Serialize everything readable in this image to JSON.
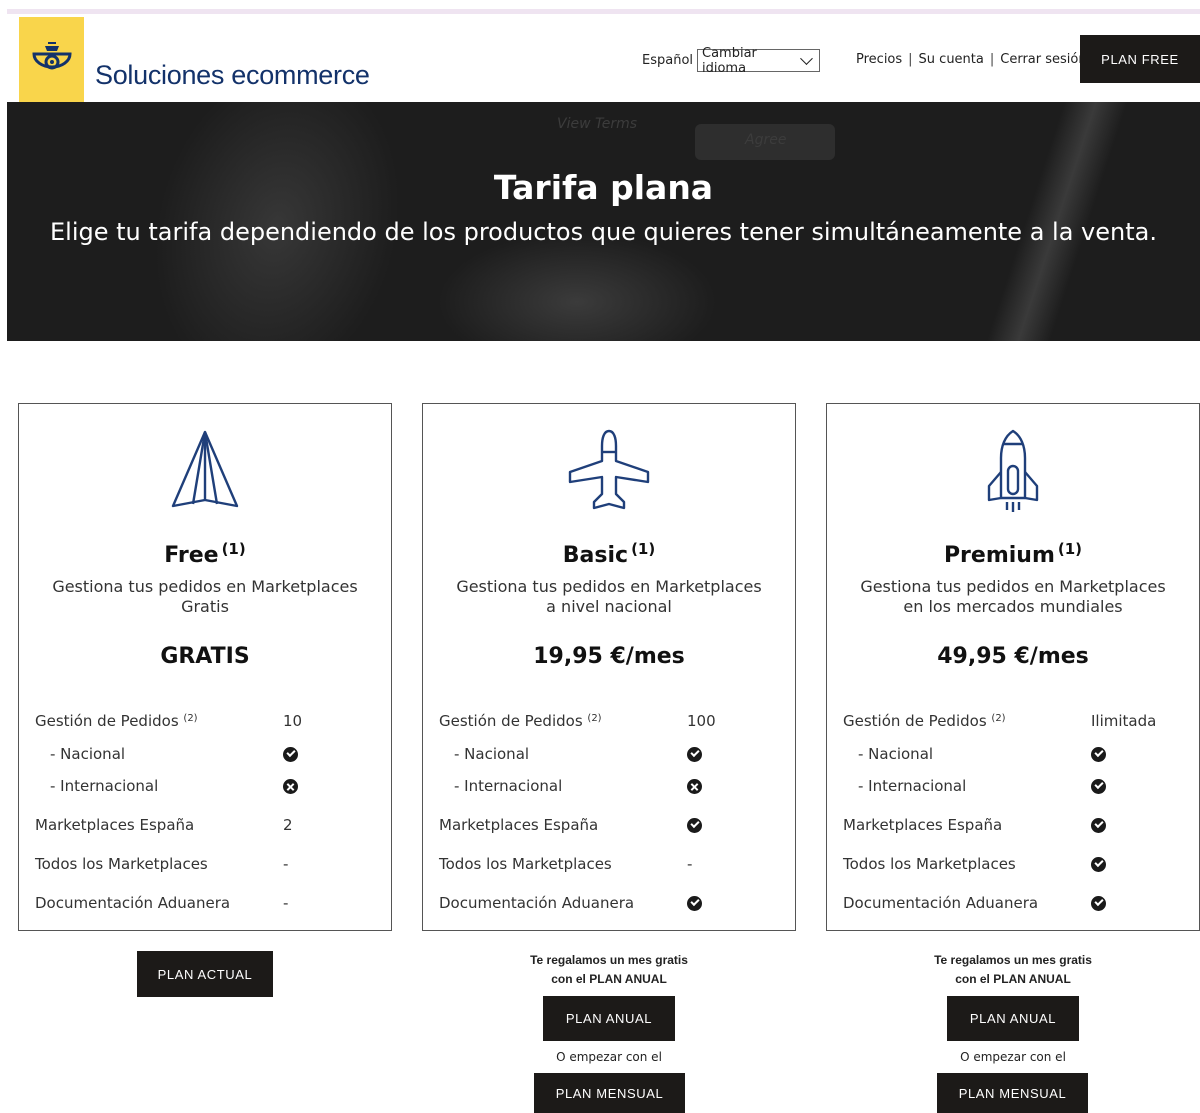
{
  "header": {
    "brand": "Soluciones ecommerce",
    "language_label": "Español",
    "language_select": "Cambiar idioma",
    "links": [
      "Precios",
      "Su cuenta",
      "Cerrar sesión"
    ],
    "cta": "PLAN FREE"
  },
  "hero": {
    "title": "Tarifa plana",
    "subtitle": "Elige tu tarifa dependiendo de los productos que quieres tener simultáneamente a la venta.",
    "bg_text_1": "View Terms",
    "bg_text_2": "Agree"
  },
  "plans": [
    {
      "icon": "paper-plane-icon",
      "name": "Free",
      "note": "(1)",
      "description": "Gestiona tus pedidos en Marketplaces Gratis",
      "price": "GRATIS",
      "features": [
        {
          "label": "Gestión de Pedidos",
          "sup": "(2)",
          "value": "10"
        },
        {
          "label": "- Nacional",
          "value": "check"
        },
        {
          "label": "- Internacional",
          "value": "cross"
        },
        {
          "label": "Marketplaces España",
          "value": "2"
        },
        {
          "label": "Todos los Marketplaces",
          "value": "-"
        },
        {
          "label": "Documentación Aduanera",
          "value": "-"
        }
      ],
      "button": "PLAN ACTUAL"
    },
    {
      "icon": "airplane-icon",
      "name": "Basic",
      "note": "(1)",
      "description": "Gestiona tus pedidos en Marketplaces a nivel nacional",
      "price": "19,95 €/mes",
      "features": [
        {
          "label": "Gestión de Pedidos",
          "sup": "(2)",
          "value": "100"
        },
        {
          "label": "- Nacional",
          "value": "check"
        },
        {
          "label": "- Internacional",
          "value": "cross"
        },
        {
          "label": "Marketplaces España",
          "value": "check"
        },
        {
          "label": "Todos los Marketplaces",
          "value": "-"
        },
        {
          "label": "Documentación Aduanera",
          "value": "check"
        }
      ],
      "promo_line1": "Te regalamos un mes gratis",
      "promo_line2": "con el PLAN ANUAL",
      "button_annual": "PLAN ANUAL",
      "or_text": "O empezar con el",
      "button_monthly": "PLAN MENSUAL"
    },
    {
      "icon": "rocket-icon",
      "name": "Premium",
      "note": "(1)",
      "description": "Gestiona tus pedidos en Marketplaces en los mercados mundiales",
      "price": "49,95 €/mes",
      "features": [
        {
          "label": "Gestión de Pedidos",
          "sup": "(2)",
          "value": "Ilimitada"
        },
        {
          "label": "- Nacional",
          "value": "check"
        },
        {
          "label": "- Internacional",
          "value": "check"
        },
        {
          "label": "Marketplaces España",
          "value": "check"
        },
        {
          "label": "Todos los Marketplaces",
          "value": "check"
        },
        {
          "label": "Documentación Aduanera",
          "value": "check"
        }
      ],
      "promo_line1": "Te regalamos un mes gratis",
      "promo_line2": "con el PLAN ANUAL",
      "button_annual": "PLAN ANUAL",
      "or_text": "O empezar con el",
      "button_monthly": "PLAN MENSUAL"
    }
  ],
  "colors": {
    "brand_blue": "#13326a",
    "logo_yellow": "#f9d54b",
    "button_dark": "#1c1a18"
  }
}
